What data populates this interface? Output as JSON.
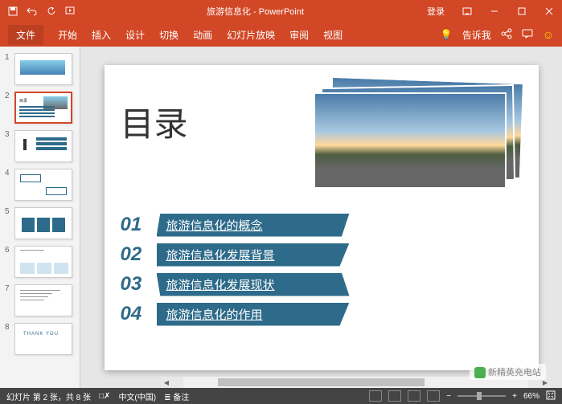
{
  "titlebar": {
    "doc_title": "旅游信息化 - PowerPoint",
    "login": "登录"
  },
  "ribbon": {
    "file": "文件",
    "home": "开始",
    "insert": "插入",
    "design": "设计",
    "transitions": "切换",
    "animations": "动画",
    "slideshow": "幻灯片放映",
    "review": "审阅",
    "view": "视图",
    "tellme": "告诉我"
  },
  "thumbnails": [
    "1",
    "2",
    "3",
    "4",
    "5",
    "6",
    "7",
    "8"
  ],
  "slide": {
    "title": "目录",
    "toc": [
      {
        "num": "01",
        "label": "旅游信息化的概念"
      },
      {
        "num": "02",
        "label": "旅游信息化发展背景"
      },
      {
        "num": "03",
        "label": "旅游信息化发展现状"
      },
      {
        "num": "04",
        "label": "旅游信息化的作用"
      }
    ]
  },
  "statusbar": {
    "slide_info": "幻灯片 第 2 张，共 8 张",
    "language": "中文(中国)",
    "notes": "备注",
    "zoom": "66%"
  },
  "watermark": "新精英充电站"
}
